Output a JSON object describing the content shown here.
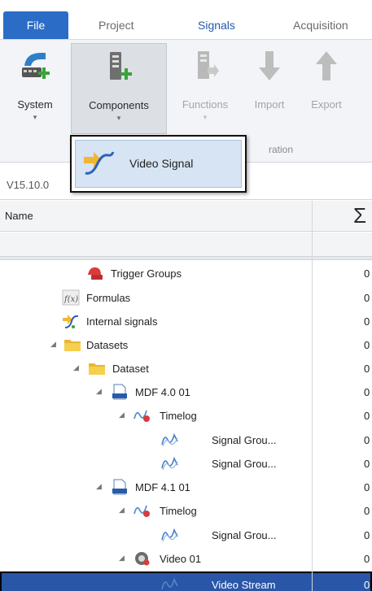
{
  "menu": {
    "tabs": [
      {
        "label": "File"
      },
      {
        "label": "Project"
      },
      {
        "label": "Signals"
      },
      {
        "label": "Acquisition"
      }
    ]
  },
  "ribbon": {
    "system_label": "System",
    "components_label": "Components",
    "functions_label": "Functions",
    "import_label": "Import",
    "export_label": "Export",
    "group_label": "ration",
    "dropdown_arrow": "▾"
  },
  "dropdown": {
    "item_label": "Video Signal"
  },
  "version": {
    "text": "V15.10.0"
  },
  "grid": {
    "name_header": "Name",
    "sum_header": "Σ"
  },
  "tree": {
    "expand_glyph": "◢",
    "rows": [
      {
        "label": "Trigger Groups",
        "value": "0"
      },
      {
        "label": "Formulas",
        "value": "0"
      },
      {
        "label": "Internal signals",
        "value": "0"
      },
      {
        "label": "Datasets",
        "value": "0"
      },
      {
        "label": "Dataset",
        "value": "0"
      },
      {
        "label": "MDF 4.0 01",
        "value": "0"
      },
      {
        "label": "Timelog",
        "value": "0"
      },
      {
        "label": "Signal Grou...",
        "value": "0"
      },
      {
        "label": "Signal Grou...",
        "value": "0"
      },
      {
        "label": "MDF 4.1 01",
        "value": "0"
      },
      {
        "label": "Timelog",
        "value": "0"
      },
      {
        "label": "Signal Grou...",
        "value": "0"
      },
      {
        "label": "Video 01",
        "value": "0"
      },
      {
        "label": "Video Stream",
        "value": "0"
      }
    ]
  },
  "colors": {
    "file_tab": "#2b6cc7",
    "signals_tab": "#2559b0",
    "selection": "#2a56a8",
    "dropdown_highlight": "#d6e4f3"
  }
}
